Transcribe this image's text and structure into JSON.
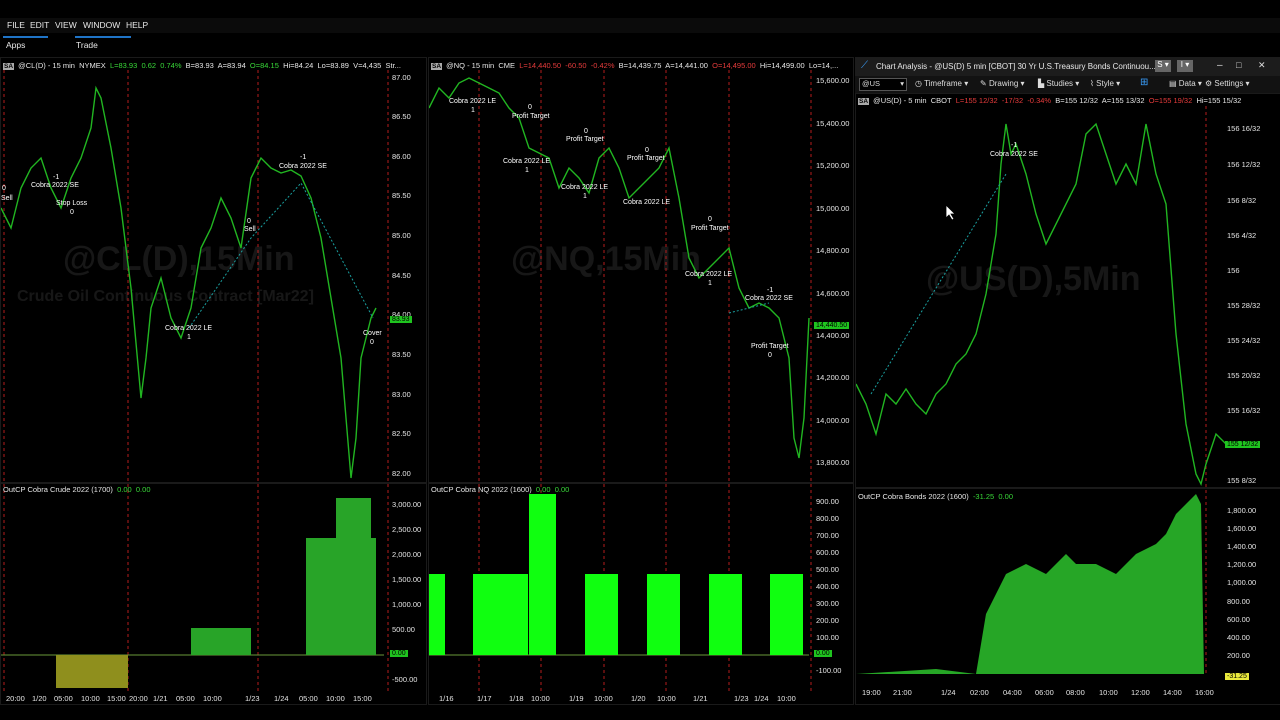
{
  "menu": {
    "items": [
      "FILE",
      "EDIT",
      "VIEW",
      "WINDOW",
      "HELP"
    ],
    "sub": [
      "Apps",
      "Trade"
    ]
  },
  "chart1": {
    "header": {
      "symbol": "@CL(D) - 15 min",
      "exchange": "NYMEX",
      "last": "L=83.93",
      "change": "0.62",
      "pct": "0.74%",
      "bid": "B=83.93",
      "ask": "A=83.94",
      "open": "O=84.15",
      "high": "Hi=84.24",
      "low": "Lo=83.89",
      "vol": "V=4,435",
      "extra": "Str..."
    },
    "watermark": "@CL(D),15Min",
    "watermark2": "Crude Oil Continuous Contract [Mar22]",
    "yticks": [
      "87.00",
      "86.50",
      "86.00",
      "85.50",
      "85.00",
      "84.50",
      "84.00",
      "83.50",
      "83.00",
      "82.50",
      "82.00"
    ],
    "price_tag": "83.93",
    "annotations": [
      "Cobra 2022 SE",
      "-1",
      "Stop Loss",
      "0",
      "Sell",
      "0",
      "Cobra 2022 LE",
      "1",
      "Cobra 2022 SE",
      "-1",
      "Cover",
      "0",
      "Sell",
      "0"
    ],
    "indicator": {
      "label": "OutCP Cobra Crude 2022 (1700)",
      "v1": "0.00",
      "v2": "0.00",
      "yticks": [
        "3,000.00",
        "2,500.00",
        "2,000.00",
        "1,500.00",
        "1,000.00",
        "500.00",
        "0.00",
        "-500.00"
      ],
      "zero_tag": "0.00"
    },
    "xticks": [
      "20:00",
      "1/20",
      "05:00",
      "10:00",
      "15:00",
      "20:00",
      "1/21",
      "05:00",
      "10:00",
      "1/23",
      "1/24",
      "05:00",
      "10:00",
      "15:00"
    ]
  },
  "chart2": {
    "header": {
      "symbol": "@NQ - 15 min",
      "exchange": "CME",
      "last": "L=14,440.50",
      "change": "-60.50",
      "pct": "-0.42%",
      "bid": "B=14,439.75",
      "ask": "A=14,441.00",
      "open": "O=14,495.00",
      "high": "Hi=14,499.00",
      "low": "Lo=14,..."
    },
    "watermark": "@NQ,15Min",
    "yticks": [
      "15,600.00",
      "15,400.00",
      "15,200.00",
      "15,000.00",
      "14,800.00",
      "14,600.00",
      "14,400.00",
      "14,200.00",
      "14,000.00",
      "13,800.00"
    ],
    "price_tag": "14,440.50",
    "annotations": [
      "Cobra 2022 LE",
      "1",
      "0",
      "Profit Target",
      "Cobra 2022 LE",
      "1",
      "0",
      "Profit Target",
      "Cobra 2022 LE",
      "1",
      "0",
      "Profit Target",
      "Cobra 2022 LE",
      "0",
      "Profit Target",
      "Cobra 2022 LE",
      "1",
      "-1",
      "Cobra 2022 SE",
      "Profit Target",
      "0"
    ],
    "indicator": {
      "label": "OutCP Cobra NQ 2022 (1600)",
      "v1": "0.00",
      "v2": "0.00",
      "yticks": [
        "900.00",
        "800.00",
        "700.00",
        "600.00",
        "500.00",
        "400.00",
        "300.00",
        "200.00",
        "100.00",
        "0.00",
        "-100.00"
      ],
      "zero_tag": "0.00"
    },
    "xticks": [
      "1/16",
      "1/17",
      "1/18",
      "10:00",
      "1/19",
      "10:00",
      "1/20",
      "10:00",
      "1/21",
      "1/23",
      "1/24",
      "10:00"
    ]
  },
  "chart3": {
    "title": "Chart Analysis - @US(D) 5 min [CBOT] 30 Yr U.S.Treasury Bonds Continuou...",
    "symbol_box": "@US",
    "toolbar": [
      "Timeframe",
      "Drawing",
      "Studies",
      "Style",
      "Data",
      "Settings"
    ],
    "header": {
      "symbol": "@US(D) - 5 min",
      "exchange": "CBOT",
      "last": "L=155 12/32",
      "change": "-17/32",
      "pct": "-0.34%",
      "bid": "B=155 12/32",
      "ask": "A=155 13/32",
      "open": "O=155 19/32",
      "high": "Hi=155 15/32"
    },
    "watermark": "@US(D),5Min",
    "yticks": [
      "156 16/32",
      "156 12/32",
      "156 8/32",
      "156 4/32",
      "156",
      "155 28/32",
      "155 24/32",
      "155 20/32",
      "155 16/32",
      "155 12/32",
      "155 8/32"
    ],
    "price_tag": "155 12/32",
    "annotations": [
      "-1",
      "Cobra 2022 SE"
    ],
    "indicator": {
      "label": "OutCP Cobra Bonds 2022 (1600)",
      "v1": "-31.25",
      "v2": "0.00",
      "yticks": [
        "1,800.00",
        "1,600.00",
        "1,400.00",
        "1,200.00",
        "1,000.00",
        "800.00",
        "600.00",
        "400.00",
        "200.00"
      ],
      "value_tag": "-31.25"
    },
    "xticks": [
      "19:00",
      "21:00",
      "1/24",
      "02:00",
      "04:00",
      "06:00",
      "08:00",
      "10:00",
      "12:00",
      "14:00",
      "16:00"
    ]
  }
}
